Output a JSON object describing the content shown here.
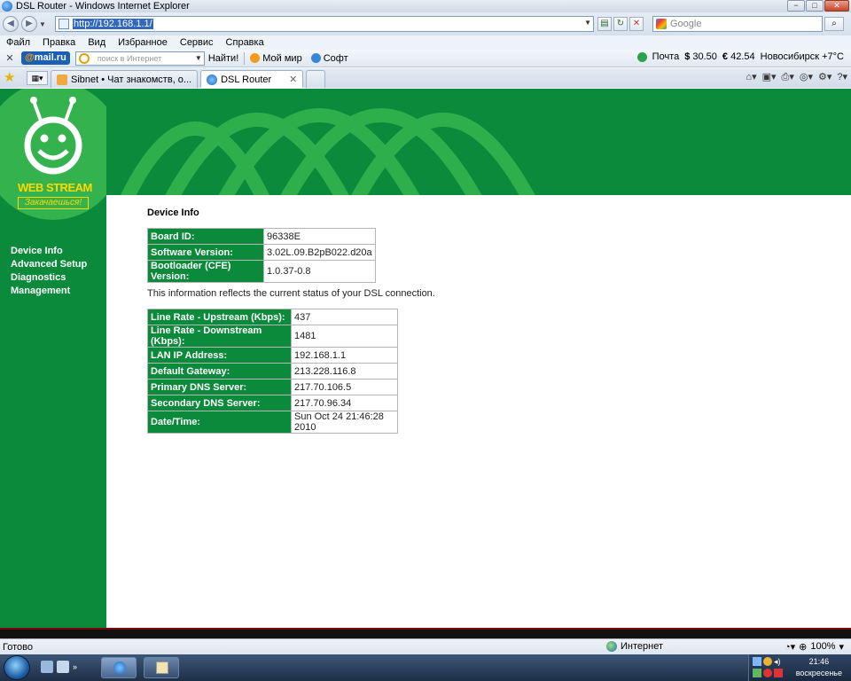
{
  "window": {
    "title": "DSL Router - Windows Internet Explorer",
    "minimize": "−",
    "maximize": "□",
    "close": "✕"
  },
  "address_bar": {
    "url": "http://192.168.1.1/",
    "search_placeholder": "Google"
  },
  "menu": [
    "Файл",
    "Правка",
    "Вид",
    "Избранное",
    "Сервис",
    "Справка"
  ],
  "mailru_toolbar": {
    "logo_prefix": "@",
    "logo_text": "mail.ru",
    "search_placeholder": "поиск в Интернет",
    "find_label": "Найти!",
    "links": [
      "Мой мир",
      "Софт"
    ],
    "mail_label": "Почта",
    "usd_symbol": "$",
    "usd_value": "30.50",
    "eur_symbol": "€",
    "eur_value": "42.54",
    "weather": "Новосибирск +7°C"
  },
  "tabs": [
    {
      "label": "Sibnet • Чат знакомств, о...",
      "active": false
    },
    {
      "label": "DSL Router",
      "active": true
    }
  ],
  "brand": {
    "name": "WEB STREAM",
    "tagline": "Закачаешься!"
  },
  "nav": [
    "Device Info",
    "Advanced Setup",
    "Diagnostics",
    "Management"
  ],
  "page": {
    "heading": "Device Info",
    "device_table": [
      {
        "label": "Board ID:",
        "value": "96338E"
      },
      {
        "label": "Software Version:",
        "value": "3.02L.09.B2pB022.d20a"
      },
      {
        "label": "Bootloader (CFE) Version:",
        "value": "1.0.37-0.8"
      }
    ],
    "status_text": "This information reflects the current status of your DSL connection.",
    "status_table": [
      {
        "label": "Line Rate - Upstream (Kbps):",
        "value": "437"
      },
      {
        "label": "Line Rate - Downstream (Kbps):",
        "value": "1481"
      },
      {
        "label": "LAN IP Address:",
        "value": "192.168.1.1"
      },
      {
        "label": "Default Gateway:",
        "value": "213.228.116.8"
      },
      {
        "label": "Primary DNS Server:",
        "value": "217.70.106.5"
      },
      {
        "label": "Secondary DNS Server:",
        "value": "217.70.96.34"
      },
      {
        "label": "Date/Time:",
        "value": "Sun Oct 24 21:46:28 2010"
      }
    ]
  },
  "statusbar": {
    "ready": "Готово",
    "zone": "Интернет",
    "zoom": "100%"
  },
  "taskbar": {
    "time": "21:46",
    "day": "воскресенье"
  },
  "colors": {
    "brand_green": "#0a8a3a",
    "light_green": "#34b24e"
  }
}
